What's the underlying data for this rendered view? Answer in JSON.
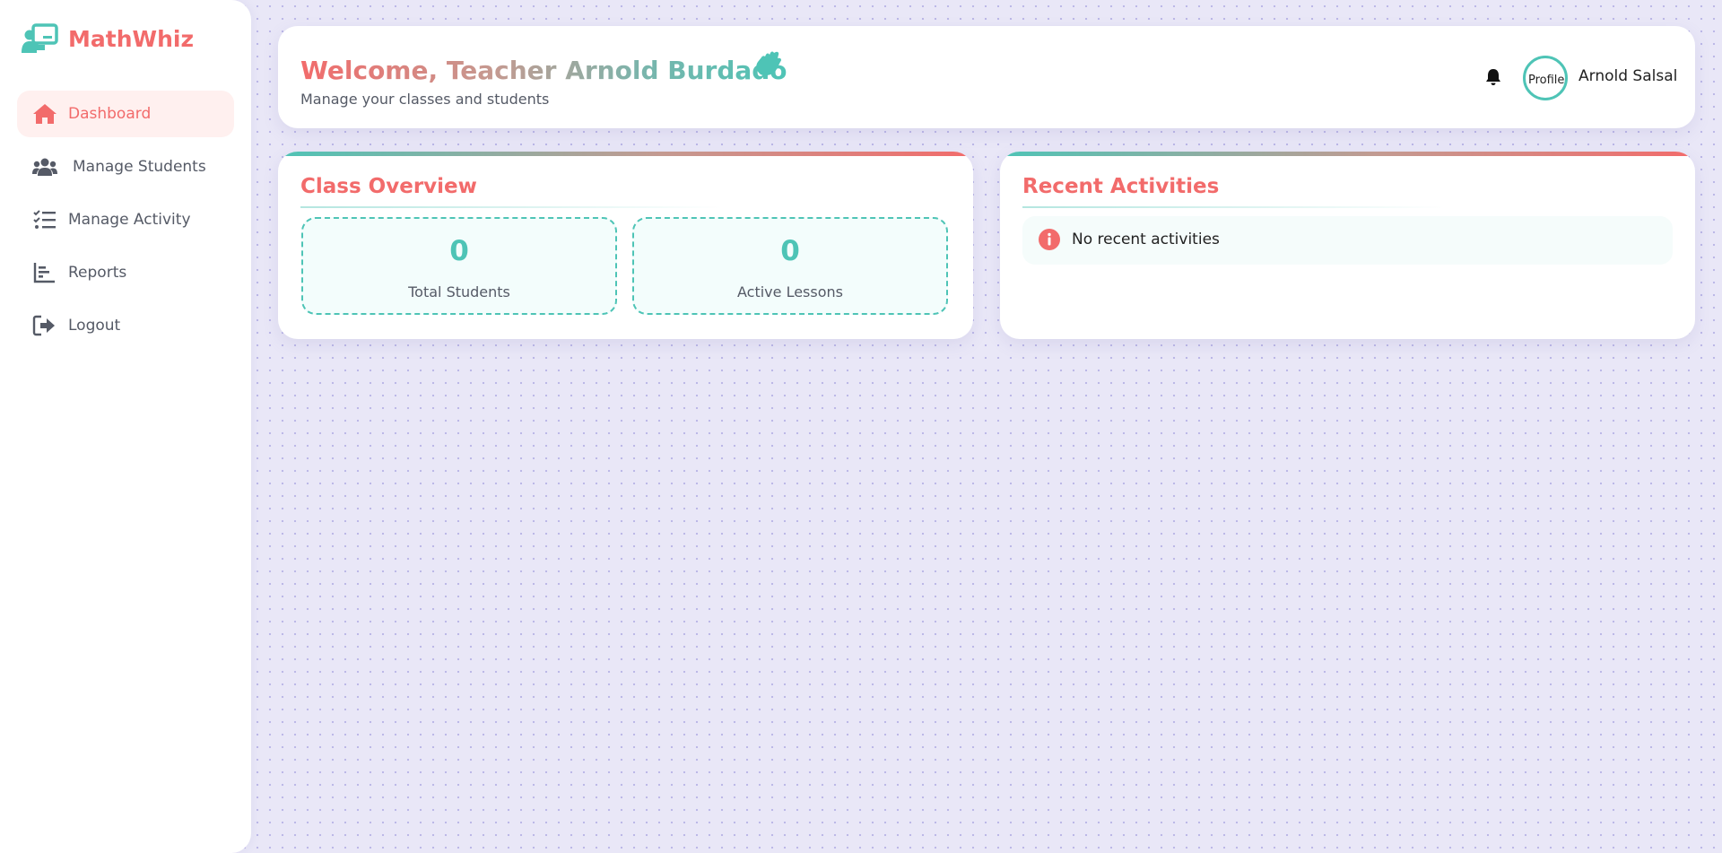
{
  "brand": {
    "name": "MathWhiz",
    "icon": "chalkboard-teacher-icon"
  },
  "sidebar": {
    "items": [
      {
        "label": "Dashboard",
        "icon": "home-icon",
        "active": true
      },
      {
        "label": "Manage Students",
        "icon": "users-icon",
        "active": false
      },
      {
        "label": "Manage Activity",
        "icon": "tasks-icon",
        "active": false
      },
      {
        "label": "Reports",
        "icon": "chart-bar-icon",
        "active": false
      },
      {
        "label": "Logout",
        "icon": "sign-out-icon",
        "active": false
      }
    ]
  },
  "header": {
    "welcome": "Welcome, Teacher Arnold Burdado",
    "wave_icon": "waving-hand-icon",
    "subtitle": "Manage your classes and students",
    "bell_icon": "bell-icon",
    "avatar_alt": "Profile",
    "user_name": "Arnold Salsal"
  },
  "overview": {
    "title": "Class Overview",
    "stats": [
      {
        "value": "0",
        "label": "Total Students"
      },
      {
        "value": "0",
        "label": "Active Lessons"
      }
    ]
  },
  "activities": {
    "title": "Recent Activities",
    "empty_text": "No recent activities",
    "empty_icon": "info-circle-icon"
  },
  "colors": {
    "accent_coral": "#f26b6b",
    "accent_teal": "#4ec4b6",
    "background": "#e9e7f7",
    "text_muted": "#555a66"
  }
}
